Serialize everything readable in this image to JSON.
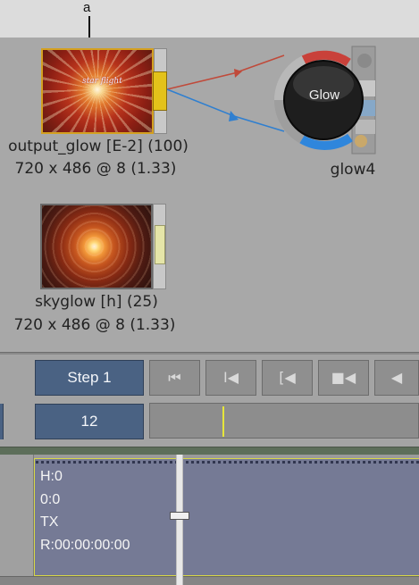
{
  "callout": {
    "letter": "a"
  },
  "nodes": {
    "output": {
      "thumb_logo": "star flight",
      "name": "output_glow [E-2] (100)",
      "resolution": "720 x 486 @ 8 (1.33)"
    },
    "sky": {
      "name": "skyglow [h] (25)",
      "resolution": "720 x 486 @ 8 (1.33)"
    },
    "glow": {
      "button_label": "Glow",
      "name": "glow4"
    }
  },
  "links": {
    "front_color": "#c04a3a",
    "back_color": "#2f7fd0"
  },
  "transport": {
    "step_label": "Step 1",
    "frame_value": "12",
    "buttons": [
      {
        "icon": "go-to-start-icon",
        "glyph": "⏮"
      },
      {
        "icon": "previous-keyframe-icon",
        "glyph": "I◀"
      },
      {
        "icon": "previous-edit-icon",
        "glyph": "[◀"
      },
      {
        "icon": "step-back-icon",
        "glyph": "■◀"
      },
      {
        "icon": "play-reverse-icon",
        "glyph": "◀"
      }
    ]
  },
  "clip": {
    "line1": "H:0",
    "line2": "0:0",
    "line3": "TX",
    "line4": "R:00:00:00:00"
  }
}
